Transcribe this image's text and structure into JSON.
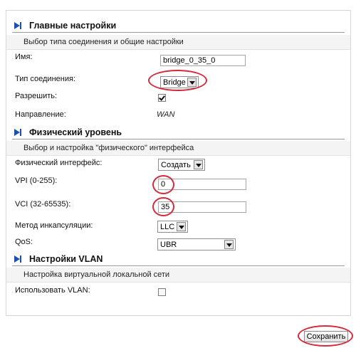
{
  "sections": {
    "main": {
      "title": "Главные настройки",
      "description": "Выбор типа соединения и общие настройки",
      "name_label": "Имя:",
      "name_value": "bridge_0_35_0",
      "conn_type_label": "Тип соединения:",
      "conn_type_value": "Bridge",
      "enable_label": "Разрешить:",
      "enable_checked": true,
      "direction_label": "Направление:",
      "direction_value": "WAN"
    },
    "physical": {
      "title": "Физический уровень",
      "description": "Выбор и настройка \"физического\" интерфейса",
      "iface_label": "Физический интерфейс:",
      "iface_value": "Создать",
      "vpi_label": "VPI (0-255):",
      "vpi_value": "0",
      "vci_label": "VCI (32-65535):",
      "vci_value": "35",
      "encap_label": "Метод инкапсуляции:",
      "encap_value": "LLC",
      "qos_label": "QoS:",
      "qos_value": "UBR"
    },
    "vlan": {
      "title": "Настройки VLAN",
      "description": "Настройка виртуальной локальной сети",
      "use_vlan_label": "Использовать VLAN:",
      "use_vlan_checked": false
    }
  },
  "save_label": "Сохранить",
  "colors": {
    "highlight": "#d42b3c",
    "section_icon": "#1d4fae"
  },
  "icons": {
    "section": "arrow-right-icon"
  }
}
